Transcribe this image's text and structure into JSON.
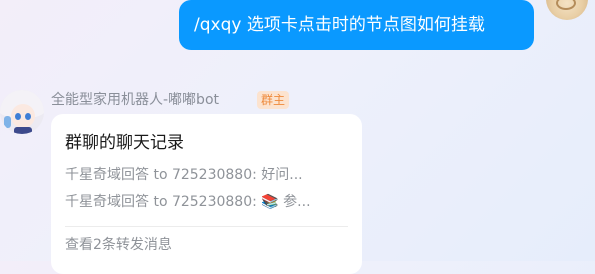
{
  "outgoing_message": {
    "text": "/qxqy 选项卡点击时的节点图如何挂载"
  },
  "sender": {
    "name": "全能型家用机器人-嘟嘟bot",
    "role": "群主"
  },
  "forwarded_record": {
    "title": "群聊的聊天记录",
    "lines": [
      "千星奇域回答 to 725230880: 好问...",
      "千星奇域回答 to 725230880: 📚 参..."
    ],
    "footer": "查看2条转发消息"
  },
  "colors": {
    "self_bubble": "#0a99ff",
    "badge_text": "#ee8a3c",
    "badge_bg": "#fce3cf"
  }
}
